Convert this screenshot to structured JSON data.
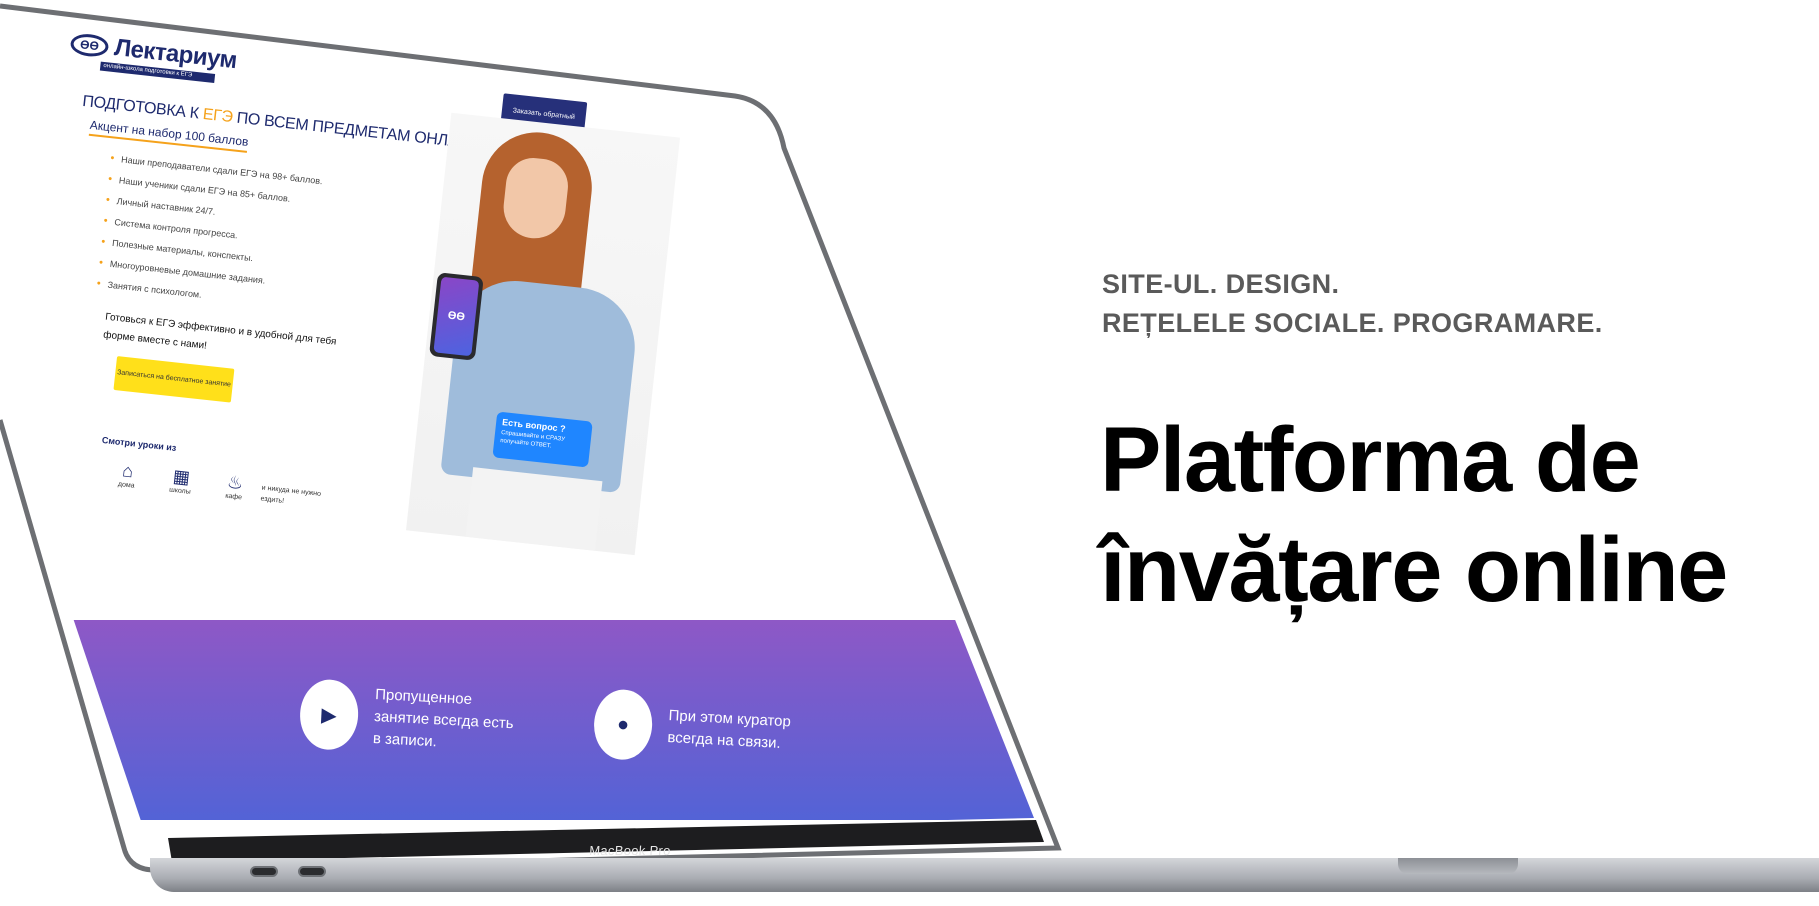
{
  "tagline": {
    "line1": "SITE-UL. DESIGN.",
    "line2": "REȚELELE SOCIALE. PROGRAMARE."
  },
  "hero": {
    "line1": "Platforma de",
    "line2": "învățare online"
  },
  "laptop": {
    "model_label": "MacBook Pro"
  },
  "site": {
    "logo_name": "Лектариум",
    "logo_tagline": "онлайн-школа подготовки к ЕГЭ",
    "callback_button": "Заказать обратный звонок",
    "headline_before": "ПОДГОТОВКА К ",
    "headline_accent": "ЕГЭ",
    "headline_after": " ПО ВСЕМ ПРЕДМЕТАМ ОНЛАЙН",
    "subheadline": "Акцент на набор 100 баллов",
    "bullets": [
      "Наши преподаватели сдали ЕГЭ на 98+ баллов.",
      "Наши ученики сдали ЕГЭ на 85+ баллов.",
      "Личный наставник 24/7.",
      "Система контроля прогресса.",
      "Полезные материалы, конспекты.",
      "Многоуровневые домашние задания.",
      "Занятия с психологом."
    ],
    "cta_text": "Готовься к ЕГЭ эффективно и в удобной для тебя форме вместе с нами!",
    "cta_button": "Записаться на бесплатное занятие",
    "watch_title": "Смотри уроки из",
    "places": [
      "дома",
      "школы",
      "кафе"
    ],
    "places_note": "и никуда не нужно ездить!",
    "bubble_title": "Есть вопрос ?",
    "bubble_text": "Спрашивайте и СРАЗУ получайте ОТВЕТ.",
    "band_item_1": "Пропущенное занятие всегда есть в записи.",
    "band_item_2": "При этом куратор всегда на связи."
  },
  "colors": {
    "brand_navy": "#1e2a6e",
    "accent_orange": "#f5a21b",
    "cta_yellow": "#ffe01a",
    "band_purple": "#8e58c6",
    "band_blue": "#5363d6",
    "bubble_blue": "#1f86ff"
  }
}
